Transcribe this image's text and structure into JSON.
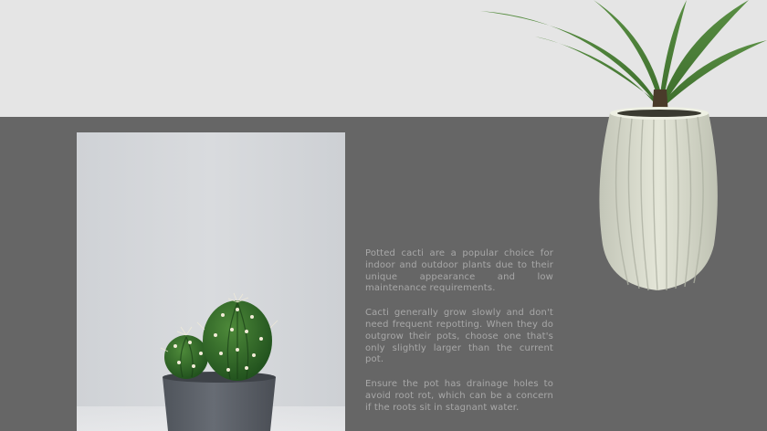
{
  "content": {
    "paragraphs": [
      "Potted cacti are a popular choice for indoor and outdoor plants due to their unique appearance and low maintenance requirements.",
      "Cacti generally grow slowly and don't need frequent repotting. When they do outgrow their pots, choose one that's only slightly larger than the current pot.",
      "Ensure the pot has drainage holes to avoid root rot, which can be a concern if the roots sit in stagnant water."
    ]
  },
  "colors": {
    "top_band": "#e5e5e5",
    "bottom_band": "#666666",
    "text": "#a8a8a8",
    "vase": "#d9dccd",
    "cactus_pot": "#5f646b",
    "cactus": "#2f6b2a",
    "leaf": "#4a7f3a"
  },
  "images": {
    "left_photo": "potted-cactus-photo",
    "right_plant": "white-ribbed-vase-plant"
  }
}
